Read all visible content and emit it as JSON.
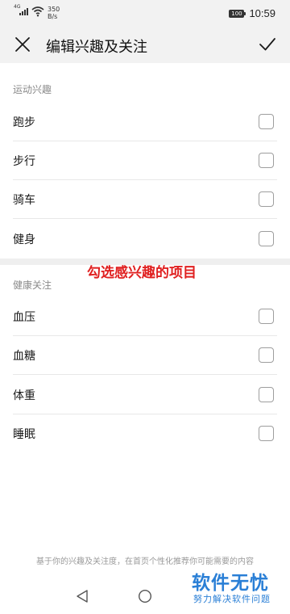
{
  "status_bar": {
    "network": "4G",
    "speed_value": "350",
    "speed_unit": "B/s",
    "battery": "100",
    "time": "10:59"
  },
  "header": {
    "title": "编辑兴趣及关注",
    "close_icon": "close-icon",
    "confirm_icon": "check-icon"
  },
  "sports": {
    "header": "运动兴趣",
    "items": [
      {
        "label": "跑步",
        "checked": false
      },
      {
        "label": "步行",
        "checked": false
      },
      {
        "label": "骑车",
        "checked": false
      },
      {
        "label": "健身",
        "checked": false
      }
    ]
  },
  "health": {
    "header": "健康关注",
    "items": [
      {
        "label": "血压",
        "checked": false
      },
      {
        "label": "血糖",
        "checked": false
      },
      {
        "label": "体重",
        "checked": false
      },
      {
        "label": "睡眠",
        "checked": false
      }
    ]
  },
  "annotation": "勾选感兴趣的项目",
  "footer_note": "基于你的兴趣及关注度，在首页个性化推荐你可能需要的内容",
  "watermark": {
    "title": "软件无忧",
    "subtitle": "努力解决软件问题"
  },
  "colors": {
    "annotation": "#e02020",
    "watermark": "#2a7fd6",
    "header_bg": "#f2f2f2"
  }
}
